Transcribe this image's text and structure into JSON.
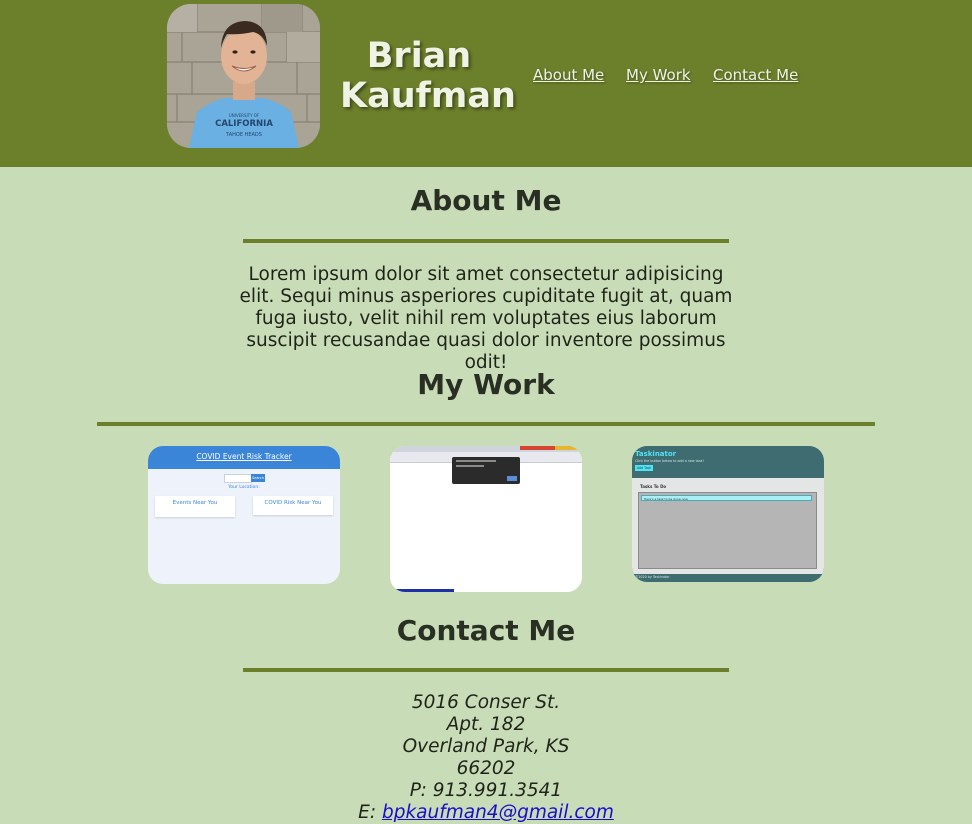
{
  "header": {
    "name_line1": "Brian",
    "name_line2": "Kaufman",
    "avatar_alt": "Profile photo",
    "nav": [
      {
        "label": "About Me"
      },
      {
        "label": "My Work"
      },
      {
        "label": "Contact Me"
      }
    ],
    "bg_color": "#6c7f2b"
  },
  "about": {
    "title": "About Me",
    "text": "Lorem ipsum dolor sit amet consectetur adipisicing elit. Sequi minus asperiores cupiditate fugit at, quam fuga iusto, velit nihil rem voluptates eius laborum suscipit recusandae quasi dolor inventore possimus odit!"
  },
  "work": {
    "title": "My Work",
    "projects": [
      {
        "title": "COVID Event Risk Tracker",
        "search_btn": "Search",
        "location_label": "Your Location:",
        "card1": "Events Near You",
        "card2": "COVID Risk Near You"
      },
      {
        "title": "Browser app screenshot"
      },
      {
        "title": "Taskinator",
        "subtitle": "Click the button below to add a new task!",
        "add_btn": "Add Task",
        "tasks_header": "Tasks To Do",
        "task": "Here's a task to be done now",
        "footer": "©2020 by Taskinator"
      }
    ]
  },
  "contact": {
    "title": "Contact Me",
    "street": "5016 Conser St.",
    "apt": "Apt. 182",
    "city": "Overland Park, KS",
    "zip": "66202",
    "phone": "P: 913.991.3541",
    "email_prefix": "E: ",
    "email": "bpkaufman4@gmail.com"
  },
  "colors": {
    "accent": "#6c7f2b",
    "background": "#c9dcb8",
    "link": "#1a0dcc"
  }
}
